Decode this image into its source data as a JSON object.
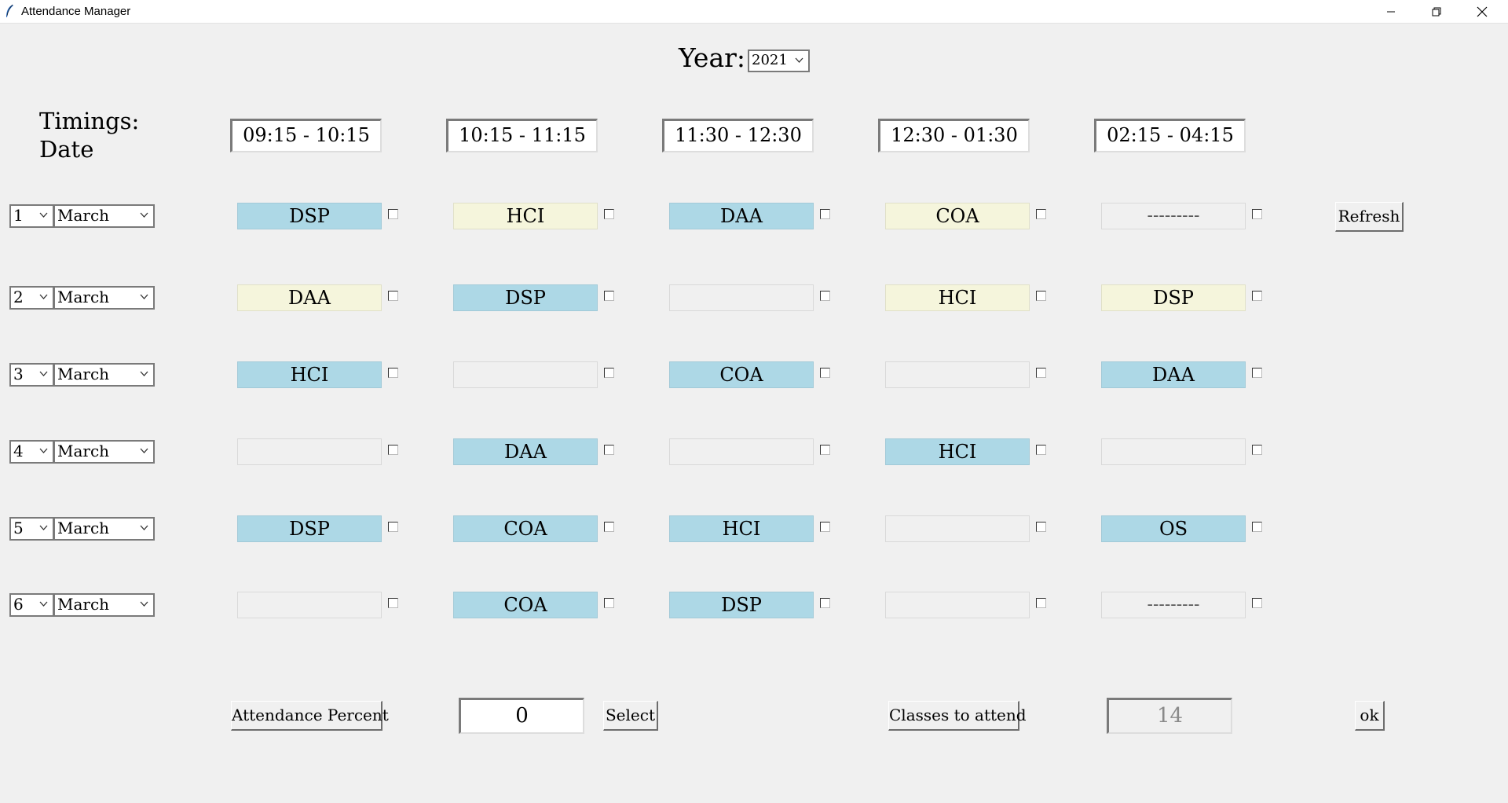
{
  "window": {
    "title": "Attendance Manager"
  },
  "header": {
    "year_label": "Year:",
    "year_value": "2021"
  },
  "timings_label": "Timings:",
  "date_label": "Date",
  "timings": [
    "09:15 - 10:15",
    "10:15 - 11:15",
    "11:30 - 12:30",
    "12:30 - 01:30",
    "02:15 - 04:15"
  ],
  "rows": [
    {
      "day": "1",
      "month": "March",
      "cells": [
        "DSP",
        "HCI",
        "DAA",
        "COA",
        "---------"
      ]
    },
    {
      "day": "2",
      "month": "March",
      "cells": [
        "DAA",
        "DSP",
        "",
        "HCI",
        "DSP"
      ]
    },
    {
      "day": "3",
      "month": "March",
      "cells": [
        "HCI",
        "",
        "COA",
        "",
        "DAA"
      ]
    },
    {
      "day": "4",
      "month": "March",
      "cells": [
        "",
        "DAA",
        "",
        "HCI",
        ""
      ]
    },
    {
      "day": "5",
      "month": "March",
      "cells": [
        "DSP",
        "COA",
        "HCI",
        "",
        "OS"
      ]
    },
    {
      "day": "6",
      "month": "March",
      "cells": [
        "",
        "COA",
        "DSP",
        "",
        "---------"
      ]
    }
  ],
  "buttons": {
    "refresh": "Refresh",
    "attendance_percent": "Attendance Percent",
    "select": "Select",
    "classes_to_attend": "Classes to attend",
    "ok": "ok"
  },
  "fields": {
    "attendance_value": "0",
    "classes_value": "14"
  },
  "colors": {
    "blue_cell": "#add8e6",
    "yellow_cell": "#f5f5dc",
    "background": "#f0f0f0"
  }
}
